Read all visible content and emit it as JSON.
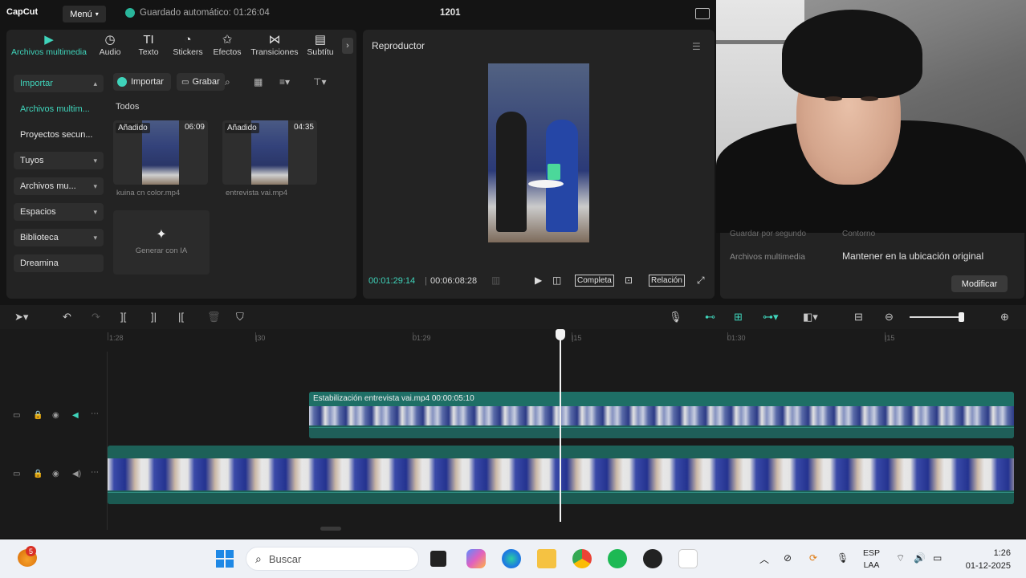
{
  "app": {
    "logo": "CapCut",
    "menu_label": "Menú",
    "autosave": "Guardado automático: 01:26:04",
    "project_title": "1201"
  },
  "media_tabs": [
    {
      "label": "Archivos multimedia",
      "icon": "media-icon"
    },
    {
      "label": "Audio",
      "icon": "audio-icon"
    },
    {
      "label": "Texto",
      "icon": "text-icon"
    },
    {
      "label": "Stickers",
      "icon": "stickers-icon"
    },
    {
      "label": "Efectos",
      "icon": "effects-icon"
    },
    {
      "label": "Transiciones",
      "icon": "transitions-icon"
    },
    {
      "label": "Subtítu",
      "icon": "subtitles-icon"
    }
  ],
  "sidebar": [
    {
      "label": "Importar"
    },
    {
      "label": "Archivos multim..."
    },
    {
      "label": "Proyectos secun..."
    },
    {
      "label": "Tuyos"
    },
    {
      "label": "Archivos mu..."
    },
    {
      "label": "Espacios"
    },
    {
      "label": "Biblioteca"
    },
    {
      "label": "Dreamina"
    }
  ],
  "media_toolbar": {
    "import_label": "Importar",
    "record_label": "Grabar"
  },
  "media_section_title": "Todos",
  "media_items": [
    {
      "badge": "Añadido",
      "duration": "06:09",
      "name": "kuina cn color.mp4"
    },
    {
      "badge": "Añadido",
      "duration": "04:35",
      "name": "entrevista vai.mp4"
    }
  ],
  "generate_ai_label": "Generar con IA",
  "player": {
    "title": "Reproductor",
    "current_time": "00:01:29:14",
    "total_time": "00:06:08:28",
    "full_label": "Completa",
    "ratio_label": "Relación"
  },
  "details": {
    "faded_label": "Guardar por segundo",
    "faded_value": "Contorno",
    "media_label": "Archivos multimedia",
    "media_value": "Mantener en la ubicación original",
    "modify_label": "Modificar"
  },
  "timeline": {
    "ruler": [
      "1:28",
      "|30",
      "01:29",
      "|15",
      "01:30",
      "|15"
    ],
    "top_clip_label": "Estabilización   entrevista vai.mp4   00:00:05:10"
  },
  "taskbar": {
    "weather_badge": "5",
    "search_placeholder": "Buscar",
    "lang_top": "ESP",
    "lang_bottom": "LAA",
    "time": "1:26",
    "date": "01-12-2025"
  },
  "colors": {
    "accent": "#3fd4bb",
    "clip": "#1f6f66",
    "panel": "#232323",
    "background": "#141414"
  }
}
